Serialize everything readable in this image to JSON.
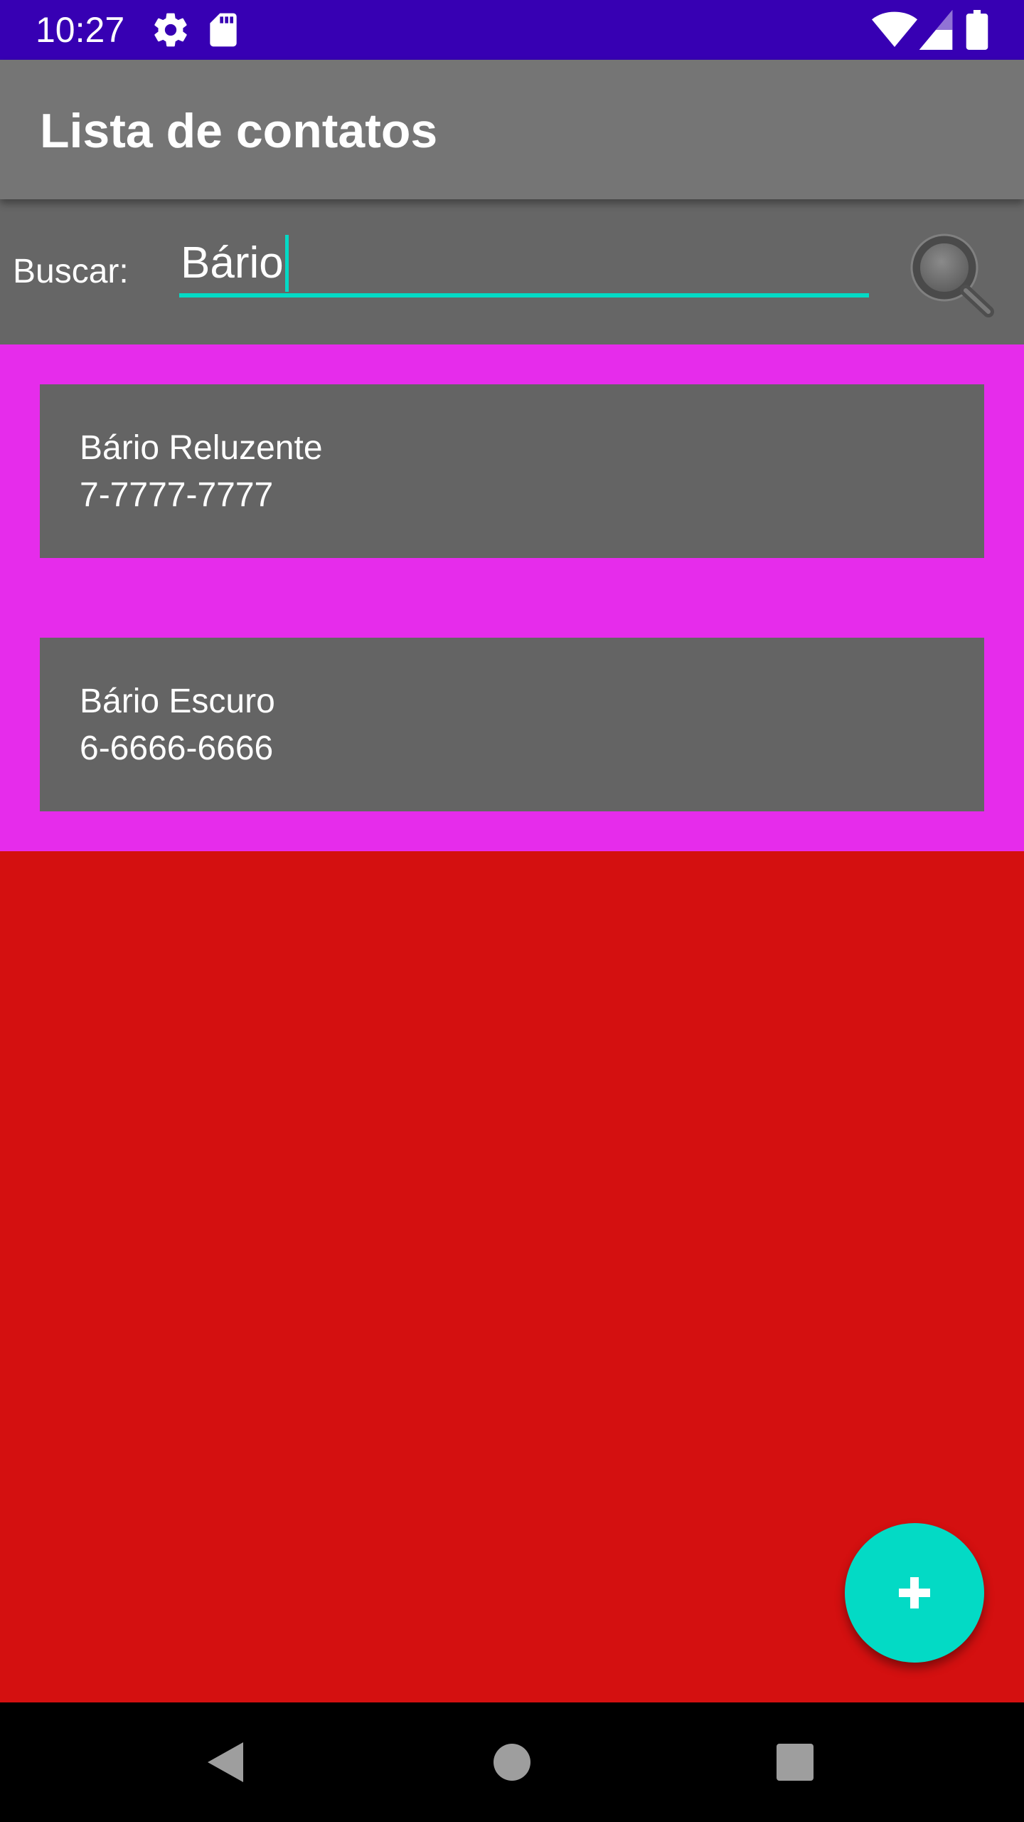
{
  "status_bar": {
    "time": "10:27",
    "icons": [
      "gear-icon",
      "sd-card-icon",
      "wifi-icon",
      "signal-icon",
      "battery-icon"
    ]
  },
  "app_bar": {
    "title": "Lista de contatos"
  },
  "search": {
    "label": "Buscar:",
    "value": "Bário",
    "button_icon": "search-icon"
  },
  "contacts": [
    {
      "name": "Bário Reluzente",
      "phone": "7-7777-7777"
    },
    {
      "name": "Bário Escuro",
      "phone": "6-6666-6666"
    }
  ],
  "fab": {
    "icon": "add-icon"
  },
  "nav_bar": {
    "icons": [
      "back-icon",
      "home-icon",
      "recents-icon"
    ]
  },
  "colors": {
    "status_bar": "#3700b3",
    "app_bar": "#757575",
    "search_row": "#666666",
    "accent": "#03dac5",
    "list_background": "#e62ceb",
    "card": "#646464",
    "page_background": "#d41010"
  }
}
